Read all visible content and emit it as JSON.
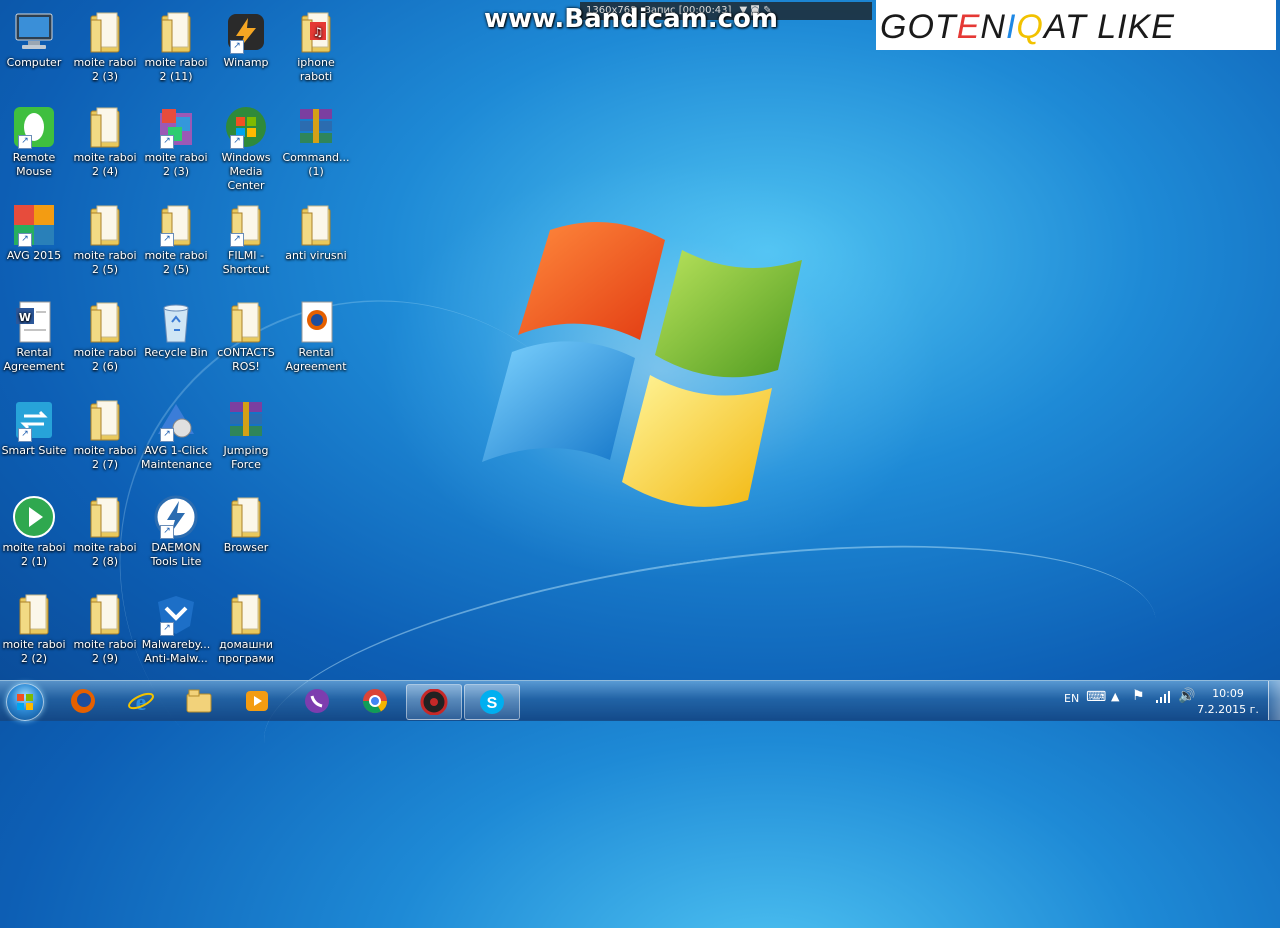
{
  "watermark": {
    "bandicam_url": "www.Bandicam.com",
    "bandicam_bar_left": "1360x768",
    "bandicam_bar_status": "Запис [00:00:43]",
    "overlay_text": "GOTENIQAT LIKE"
  },
  "desktop_icons": [
    {
      "label": "Computer",
      "icon": "computer-icon"
    },
    {
      "label": "moite raboi 2 (3)",
      "icon": "folder-icon"
    },
    {
      "label": "moite raboi 2 (11)",
      "icon": "folder-icon"
    },
    {
      "label": "Winamp",
      "icon": "winamp-icon"
    },
    {
      "label": "iphone raboti",
      "icon": "music-folder-icon"
    },
    {
      "label": "Remote Mouse",
      "icon": "remote-mouse-icon"
    },
    {
      "label": "moite raboi 2 (4)",
      "icon": "folder-icon"
    },
    {
      "label": "moite raboi 2 (3)",
      "icon": "installer-icon"
    },
    {
      "label": "Windows Media Center",
      "icon": "windows-media-center-icon"
    },
    {
      "label": "Command... (1)",
      "icon": "winrar-icon"
    },
    {
      "label": "AVG 2015",
      "icon": "avg-icon"
    },
    {
      "label": "moite raboi 2 (5)",
      "icon": "folder-icon"
    },
    {
      "label": "moite raboi 2 (5)",
      "icon": "folder-icon"
    },
    {
      "label": "FILMI - Shortcut",
      "icon": "folder-icon"
    },
    {
      "label": "anti virusni",
      "icon": "folder-icon"
    },
    {
      "label": "Rental Agreement",
      "icon": "word-document-icon"
    },
    {
      "label": "moite raboi 2 (6)",
      "icon": "folder-icon"
    },
    {
      "label": "Recycle Bin",
      "icon": "recycle-bin-icon"
    },
    {
      "label": "cONTACTS ROS!",
      "icon": "folder-icon"
    },
    {
      "label": "Rental Agreement",
      "icon": "firefox-document-icon"
    },
    {
      "label": "Smart Suite",
      "icon": "smart-suite-icon"
    },
    {
      "label": "moite raboi 2 (7)",
      "icon": "folder-icon"
    },
    {
      "label": "AVG 1-Click Maintenance",
      "icon": "avg-maintenance-icon"
    },
    {
      "label": "Jumping Force",
      "icon": "winrar-icon"
    },
    {
      "label": "moite raboi 2 (1)",
      "icon": "play-icon"
    },
    {
      "label": "moite raboi 2 (8)",
      "icon": "folder-icon"
    },
    {
      "label": "DAEMON Tools Lite",
      "icon": "daemon-tools-icon"
    },
    {
      "label": "Browser",
      "icon": "folder-icon"
    },
    {
      "label": "moite raboi 2 (2)",
      "icon": "folder-icon"
    },
    {
      "label": "moite raboi 2 (9)",
      "icon": "folder-icon"
    },
    {
      "label": "Malwareby... Anti-Malw...",
      "icon": "malwarebytes-icon"
    },
    {
      "label": "домашни програми",
      "icon": "folder-icon"
    }
  ],
  "taskbar": {
    "apps": [
      {
        "name": "firefox-icon"
      },
      {
        "name": "internet-explorer-icon"
      },
      {
        "name": "file-explorer-icon"
      },
      {
        "name": "media-player-icon"
      },
      {
        "name": "viber-icon"
      },
      {
        "name": "chrome-icon"
      },
      {
        "name": "bandicam-icon"
      },
      {
        "name": "skype-icon"
      }
    ],
    "tray": {
      "language": "EN",
      "time": "10:09",
      "date": "7.2.2015 г."
    }
  },
  "colors": {
    "wallpaper_blue": "#1e8ad6",
    "logo_red": "#f05a22",
    "logo_green": "#7cbb2a",
    "logo_blue": "#2ea0e6",
    "logo_yellow": "#f7d21c"
  }
}
